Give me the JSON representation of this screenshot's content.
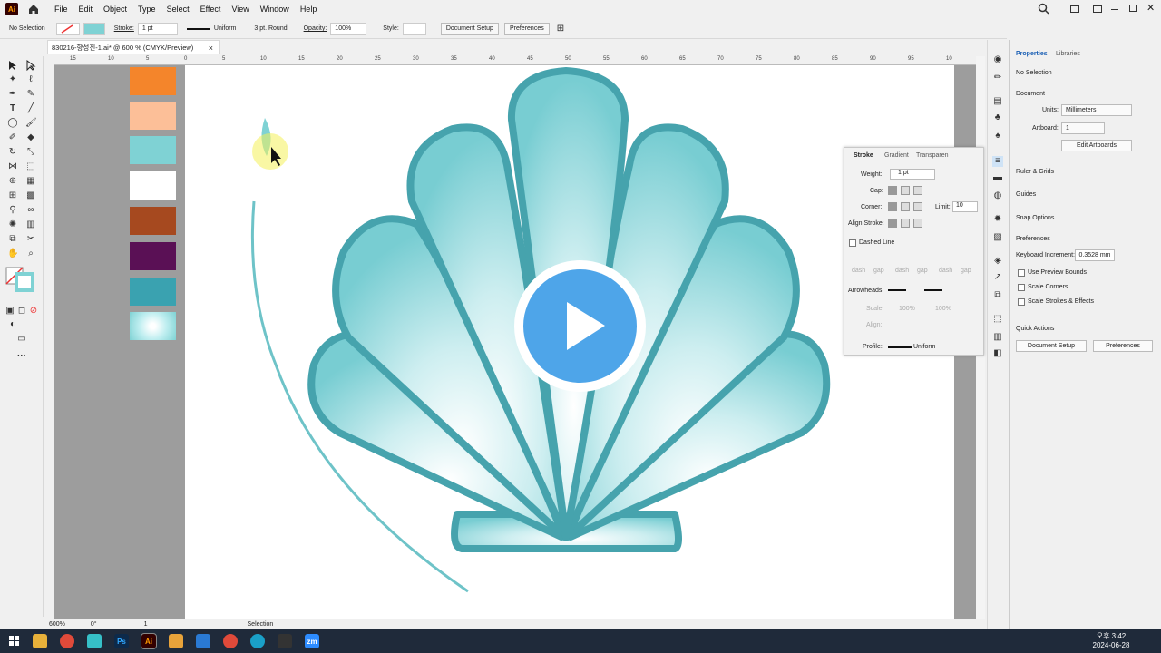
{
  "menubar": {
    "app_logo": "Ai",
    "items": [
      "File",
      "Edit",
      "Object",
      "Type",
      "Select",
      "Effect",
      "View",
      "Window",
      "Help"
    ]
  },
  "control": {
    "selection": "No Selection",
    "stroke_label": "Stroke:",
    "stroke_weight": "1 pt",
    "profile": "Uniform",
    "brush": "3 pt. Round",
    "opacity_label": "Opacity:",
    "opacity": "100%",
    "style_label": "Style:",
    "doc_setup": "Document Setup",
    "preferences": "Preferences"
  },
  "document": {
    "tab_title": "830216-향성진-1.ai* @ 600 % (CMYK/Preview)"
  },
  "ruler": {
    "top": [
      "15",
      "10",
      "5",
      "0",
      "5",
      "10",
      "15",
      "20",
      "25",
      "30",
      "35",
      "40",
      "45",
      "50",
      "55",
      "60",
      "65",
      "70",
      "75",
      "80",
      "85",
      "90",
      "95",
      "10"
    ]
  },
  "swatches": [
    {
      "color": "#f4852b"
    },
    {
      "color": "#fcbf98"
    },
    {
      "color": "#7fd2d4"
    },
    {
      "color": "#ffffff"
    },
    {
      "color": "#a6491f"
    },
    {
      "color": "#5a1055"
    },
    {
      "color": "#3aa2b0"
    },
    {
      "color": "#bfeef0"
    }
  ],
  "status": {
    "zoom": "600%",
    "rotate": "0°",
    "artboard": "1",
    "tool": "Selection"
  },
  "stroke_panel": {
    "tabs": [
      "Stroke",
      "Gradient",
      "Transparen"
    ],
    "weight_label": "Weight:",
    "weight": "1 pt",
    "cap_label": "Cap:",
    "corner_label": "Corner:",
    "limit_label": "Limit:",
    "limit": "10",
    "align_label": "Align Stroke:",
    "dashed": "Dashed Line",
    "dash_fields": [
      "dash",
      "gap",
      "dash",
      "gap",
      "dash",
      "gap"
    ],
    "arrowheads": "Arrowheads:",
    "scale_label": "Scale:",
    "scale1": "100%",
    "scale2": "100%",
    "align2": "Align:",
    "profile_label": "Profile:",
    "profile": "Uniform"
  },
  "properties": {
    "tab1": "Properties",
    "tab2": "Libraries",
    "selection": "No Selection",
    "document": "Document",
    "units_label": "Units:",
    "units": "Millimeters",
    "artboard_label": "Artboard:",
    "artboard": "1",
    "edit_artboards": "Edit Artboards",
    "rulers": "Ruler & Grids",
    "guides": "Guides",
    "snap": "Snap Options",
    "prefs": "Preferences",
    "kbd_label": "Keyboard Increment:",
    "kbd_value": "0.3528 mm",
    "use_preview": "Use Preview Bounds",
    "scale_corners": "Scale Corners",
    "scale_strokes": "Scale Strokes & Effects",
    "quick_actions": "Quick Actions",
    "qa_doc_setup": "Document Setup",
    "qa_prefs": "Preferences"
  },
  "taskbar": {
    "time": "오후 3:42",
    "date": "2024-06-28",
    "apps": [
      "Ps",
      "Ai",
      "zm"
    ]
  },
  "colors": {
    "shell_fill": "#7fcfd2",
    "shell_stroke": "#46a3ad",
    "play": "#4ea5e9"
  }
}
